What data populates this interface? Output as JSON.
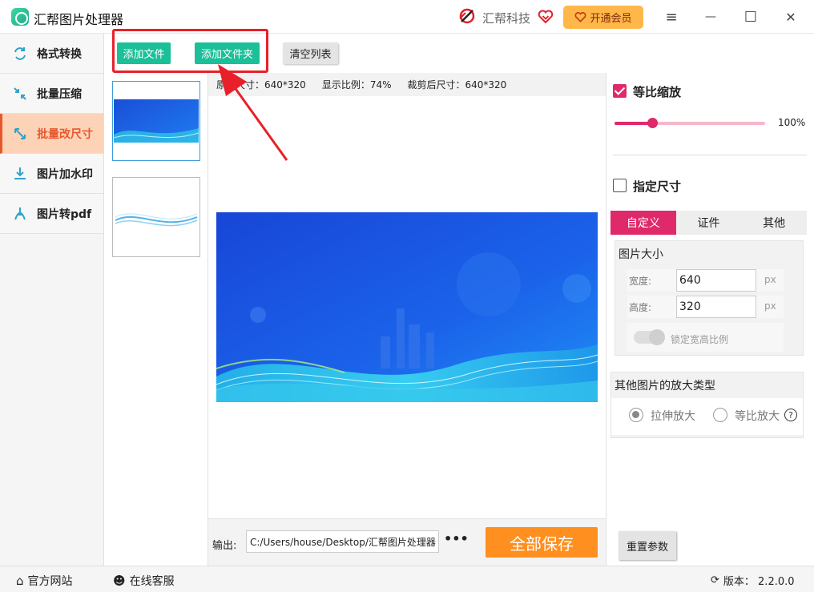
{
  "app": {
    "title": "汇帮图片处理器",
    "brand": "汇帮科技",
    "vip_label": "开通会员"
  },
  "window_controls": {
    "menu": "≡",
    "minimize": "—",
    "maximize": "☐",
    "close": "✕"
  },
  "sidebar": {
    "items": [
      {
        "label": "格式转换",
        "icon": "format-convert-icon"
      },
      {
        "label": "批量压缩",
        "icon": "compress-icon"
      },
      {
        "label": "批量改尺寸",
        "icon": "resize-icon",
        "active": true
      },
      {
        "label": "图片加水印",
        "icon": "watermark-icon"
      },
      {
        "label": "图片转pdf",
        "icon": "pdf-icon"
      }
    ]
  },
  "toolbar": {
    "add_file": "添加文件",
    "add_folder": "添加文件夹",
    "clear_list": "清空列表"
  },
  "info": {
    "original_size": "原图尺寸：640*320",
    "display_ratio": "显示比例：74%",
    "cropped_size": "裁剪后尺寸：640*320"
  },
  "output": {
    "label": "输出:",
    "path": "C:/Users/house/Desktop/汇帮图片处理器",
    "more": "•••",
    "save_all": "全部保存"
  },
  "right_panel": {
    "proportional_scale": {
      "label": "等比缩放",
      "checked": true,
      "value_label": "100%",
      "fraction": 0.25
    },
    "specify_size": {
      "label": "指定尺寸",
      "checked": false
    },
    "tabs": [
      "自定义",
      "证件",
      "其他"
    ],
    "active_tab": 0,
    "image_size": {
      "title": "图片大小",
      "width_label": "宽度:",
      "width_value": "640",
      "width_unit": "px",
      "height_label": "高度:",
      "height_value": "320",
      "height_unit": "px",
      "lock_label": "锁定宽高比例"
    },
    "enlarge": {
      "title": "其他图片的放大类型",
      "options": [
        "拉伸放大",
        "等比放大"
      ],
      "selected": 0
    },
    "reset": "重置参数"
  },
  "statusbar": {
    "website": "官方网站",
    "support": "在线客服",
    "version": "版本：  2.2.0.0"
  },
  "colors": {
    "accent": "#e0296b",
    "green": "#1bbf98",
    "orange": "#ff8f1f",
    "active_side": "#fdd3b8",
    "annotation": "#e8202a"
  }
}
